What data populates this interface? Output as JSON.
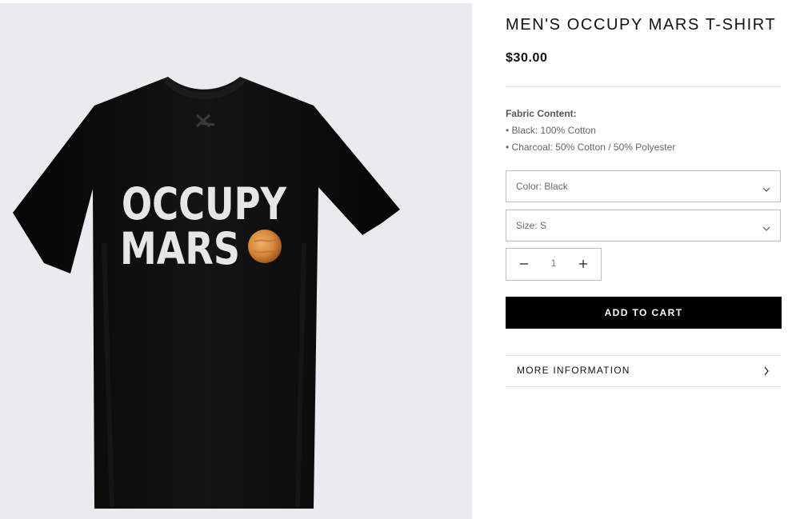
{
  "product": {
    "title": "MEN'S OCCUPY MARS T-SHIRT",
    "price": "$30.00",
    "image": {
      "print_line1": "OCCUPY",
      "print_line2": "MARS",
      "shirt_color": "#0d0d0d",
      "background_color": "#e9ebee",
      "planet_icon": "mars-planet-icon"
    }
  },
  "fabric": {
    "label": "Fabric Content:",
    "lines": [
      "• Black: 100% Cotton",
      "• Charcoal: 50% Cotton / 50% Polyester"
    ]
  },
  "options": {
    "color": {
      "value": "Color: Black",
      "icon": "chevron-down-icon"
    },
    "size": {
      "value": "Size: S",
      "icon": "chevron-down-icon"
    }
  },
  "quantity": {
    "value": "1",
    "minus_icon": "minus-icon",
    "plus_icon": "plus-icon"
  },
  "actions": {
    "add_to_cart": "ADD TO CART"
  },
  "more_information": {
    "label": "MORE INFORMATION",
    "icon": "chevron-right-icon"
  },
  "colors": {
    "accent": "#000000",
    "border": "#bdbdbd",
    "divider": "#e2e2e2"
  }
}
